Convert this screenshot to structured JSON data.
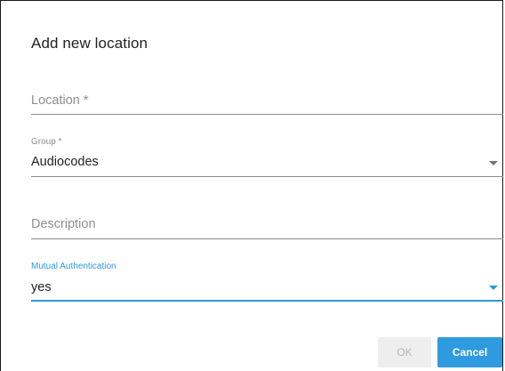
{
  "dialog": {
    "title": "Add new location",
    "fields": {
      "location": {
        "placeholder": "Location *",
        "value": ""
      },
      "group": {
        "label": "Group *",
        "value": "Audiocodes"
      },
      "description": {
        "placeholder": "Description",
        "value": ""
      },
      "mutual_auth": {
        "label": "Mutual Authentication",
        "value": "yes"
      }
    },
    "buttons": {
      "ok": "OK",
      "cancel": "Cancel"
    }
  },
  "colors": {
    "accent": "#2a9bd8",
    "cancel_bg": "#2e9be0",
    "ok_disabled_bg": "#eeeeee"
  },
  "icons": {
    "group_dropdown": "caret-down-icon",
    "mutual_auth_dropdown": "caret-down-icon"
  }
}
